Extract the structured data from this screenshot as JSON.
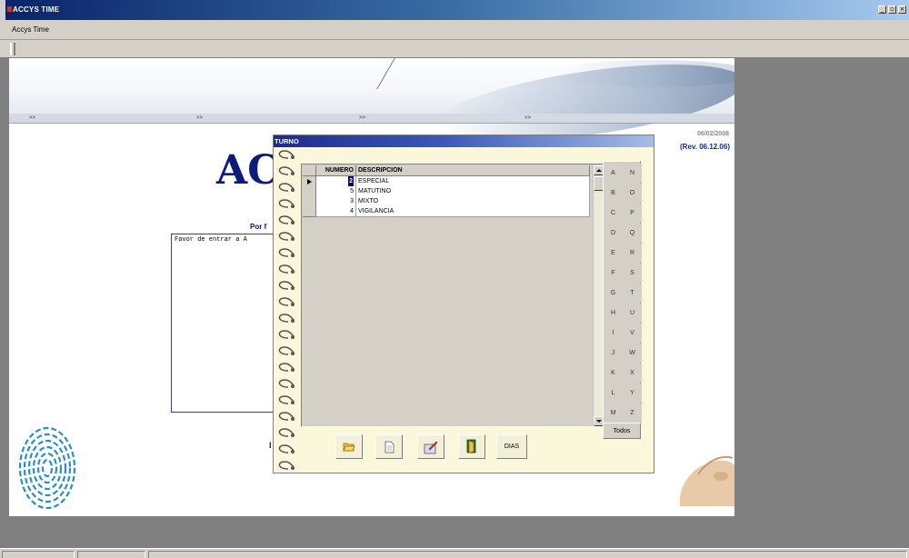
{
  "window": {
    "title": "ACCYS TIME",
    "min_glyph": "_",
    "max_glyph": "▫",
    "close_glyph": "×"
  },
  "menu": {
    "items": [
      "Accys Time"
    ]
  },
  "banner": {
    "nav": [
      ">>",
      ">>",
      ">>",
      ">>"
    ]
  },
  "main": {
    "date": "06/02/2008",
    "revision": "(Rev. 06.12.06)",
    "title_fragment": "AC",
    "prompt_fragment": "Por f",
    "message_fragment": "Favor de entrar a A",
    "trailing_fragment": "I"
  },
  "dialog": {
    "title": "TURNO",
    "table": {
      "columns": [
        "NUMERO",
        "DESCRIPCION"
      ],
      "rows": [
        {
          "numero": "2",
          "descripcion": "ESPECIAL",
          "selected": true
        },
        {
          "numero": "5",
          "descripcion": "MATUTINO",
          "selected": false
        },
        {
          "numero": "3",
          "descripcion": "MIXTO",
          "selected": false
        },
        {
          "numero": "4",
          "descripcion": "VIGILANCIA",
          "selected": false
        }
      ]
    },
    "letters_left": [
      "A",
      "B",
      "C",
      "D",
      "E",
      "F",
      "G",
      "H",
      "I",
      "J",
      "K",
      "L",
      "M"
    ],
    "letters_right": [
      "N",
      "O",
      "P",
      "Q",
      "R",
      "S",
      "T",
      "U",
      "V",
      "W",
      "X",
      "Y",
      "Z"
    ],
    "todos_label": "Todos",
    "toolbar": [
      {
        "name": "open-folder-icon"
      },
      {
        "name": "new-document-icon"
      },
      {
        "name": "edit-icon"
      },
      {
        "name": "exit-door-icon"
      }
    ],
    "dias_label": "DIAS"
  },
  "colors": {
    "title_blue": "#0d1b7a",
    "dialog_bg": "#fbf7da",
    "selection": "#000080"
  }
}
